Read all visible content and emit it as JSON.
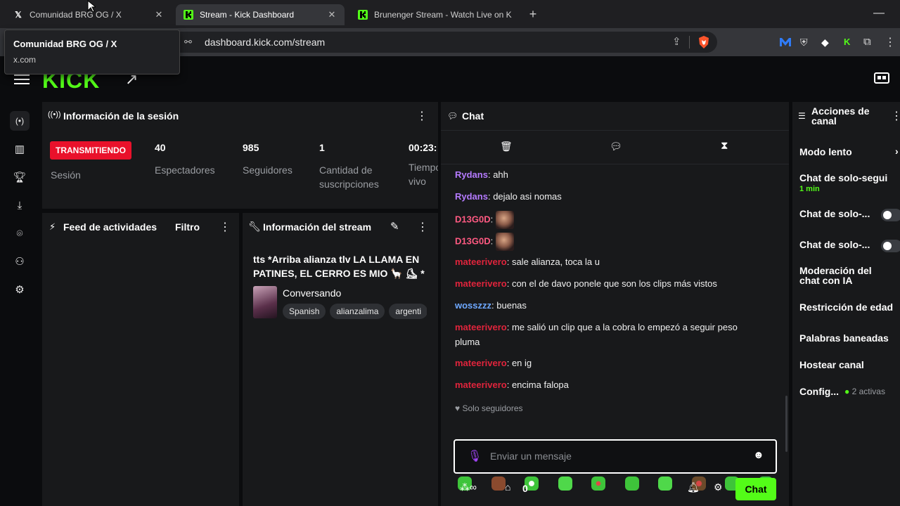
{
  "browser": {
    "tabs": [
      {
        "title": "Comunidad BRG OG / X",
        "favicon": "x-logo-icon",
        "active": false
      },
      {
        "title": "Stream - Kick Dashboard",
        "favicon": "kick-logo-icon",
        "active": true
      },
      {
        "title": "Brunenger Stream - Watch Live on Ki",
        "favicon": "kick-logo-icon",
        "active": false
      }
    ],
    "url": "dashboard.kick.com/stream",
    "tooltip": {
      "title": "Comunidad BRG OG / X",
      "domain": "x.com"
    }
  },
  "app": {
    "logo": "KICK"
  },
  "session": {
    "title": "Información de la sesión",
    "status_badge": "TRANSMITIENDO",
    "status_label": "Sesión",
    "stats": [
      {
        "value": "40",
        "label": "Espectadores"
      },
      {
        "value": "985",
        "label": "Seguidores"
      },
      {
        "value": "1",
        "label": "Cantidad de suscripciones"
      },
      {
        "value": "00:23:",
        "label": "Tiempo en vivo"
      }
    ]
  },
  "feed": {
    "title": "Feed de actividades",
    "filter_label": "Filtro"
  },
  "stream_info": {
    "title": "Información del stream",
    "stream_title": "tts *Arriba alianza tlv LA LLAMA EN PATINES, EL CERRO ES MIO 🦙 ⛸ *",
    "category": "Conversando",
    "tags": [
      "Spanish",
      "alianzalima",
      "argenti"
    ]
  },
  "chat": {
    "title": "Chat",
    "messages": [
      {
        "user": "Rydans",
        "color": "#b57bff",
        "text": "ahh"
      },
      {
        "user": "Rydans",
        "color": "#b57bff",
        "text": "dejalo asi nomas"
      },
      {
        "user": "D13G0D",
        "color": "#ff5a82",
        "text": ""
      },
      {
        "user": "D13G0D",
        "color": "#ff5a82",
        "text": ""
      },
      {
        "user": "mateerivero",
        "color": "#e0243c",
        "text": "sale alianza, toca la u"
      },
      {
        "user": "mateerivero",
        "color": "#e0243c",
        "text": "con el de davo ponele que son los clips más vistos"
      },
      {
        "user": "wosszzz",
        "color": "#6ea8ff",
        "text": "buenas"
      },
      {
        "user": "mateerivero",
        "color": "#e0243c",
        "text": "me salió un clip que a la cobra lo empezó a seguir peso pluma"
      },
      {
        "user": "mateerivero",
        "color": "#e0243c",
        "text": "en ig"
      },
      {
        "user": "mateerivero",
        "color": "#e0243c",
        "text": "encima falopa"
      }
    ],
    "followers_only": "Solo seguidores",
    "input_placeholder": "Enviar un mensaje",
    "points": "0",
    "send_label": "Chat"
  },
  "channel_actions": {
    "title": "Acciones de canal",
    "items": [
      {
        "label": "Modo lento"
      },
      {
        "label": "Chat de solo-segui",
        "sub": "1 min"
      },
      {
        "label": "Chat de solo-..."
      },
      {
        "label": "Chat de solo-..."
      },
      {
        "label": "Moderación del chat con IA"
      },
      {
        "label": "Restricción de edad"
      },
      {
        "label": "Palabras baneadas"
      },
      {
        "label": "Hostear canal"
      },
      {
        "label": "Config...",
        "sub": "2 activas"
      }
    ]
  },
  "colors": {
    "kick_green": "#53fc18",
    "live_red": "#e9112b",
    "panel": "#18191b"
  }
}
